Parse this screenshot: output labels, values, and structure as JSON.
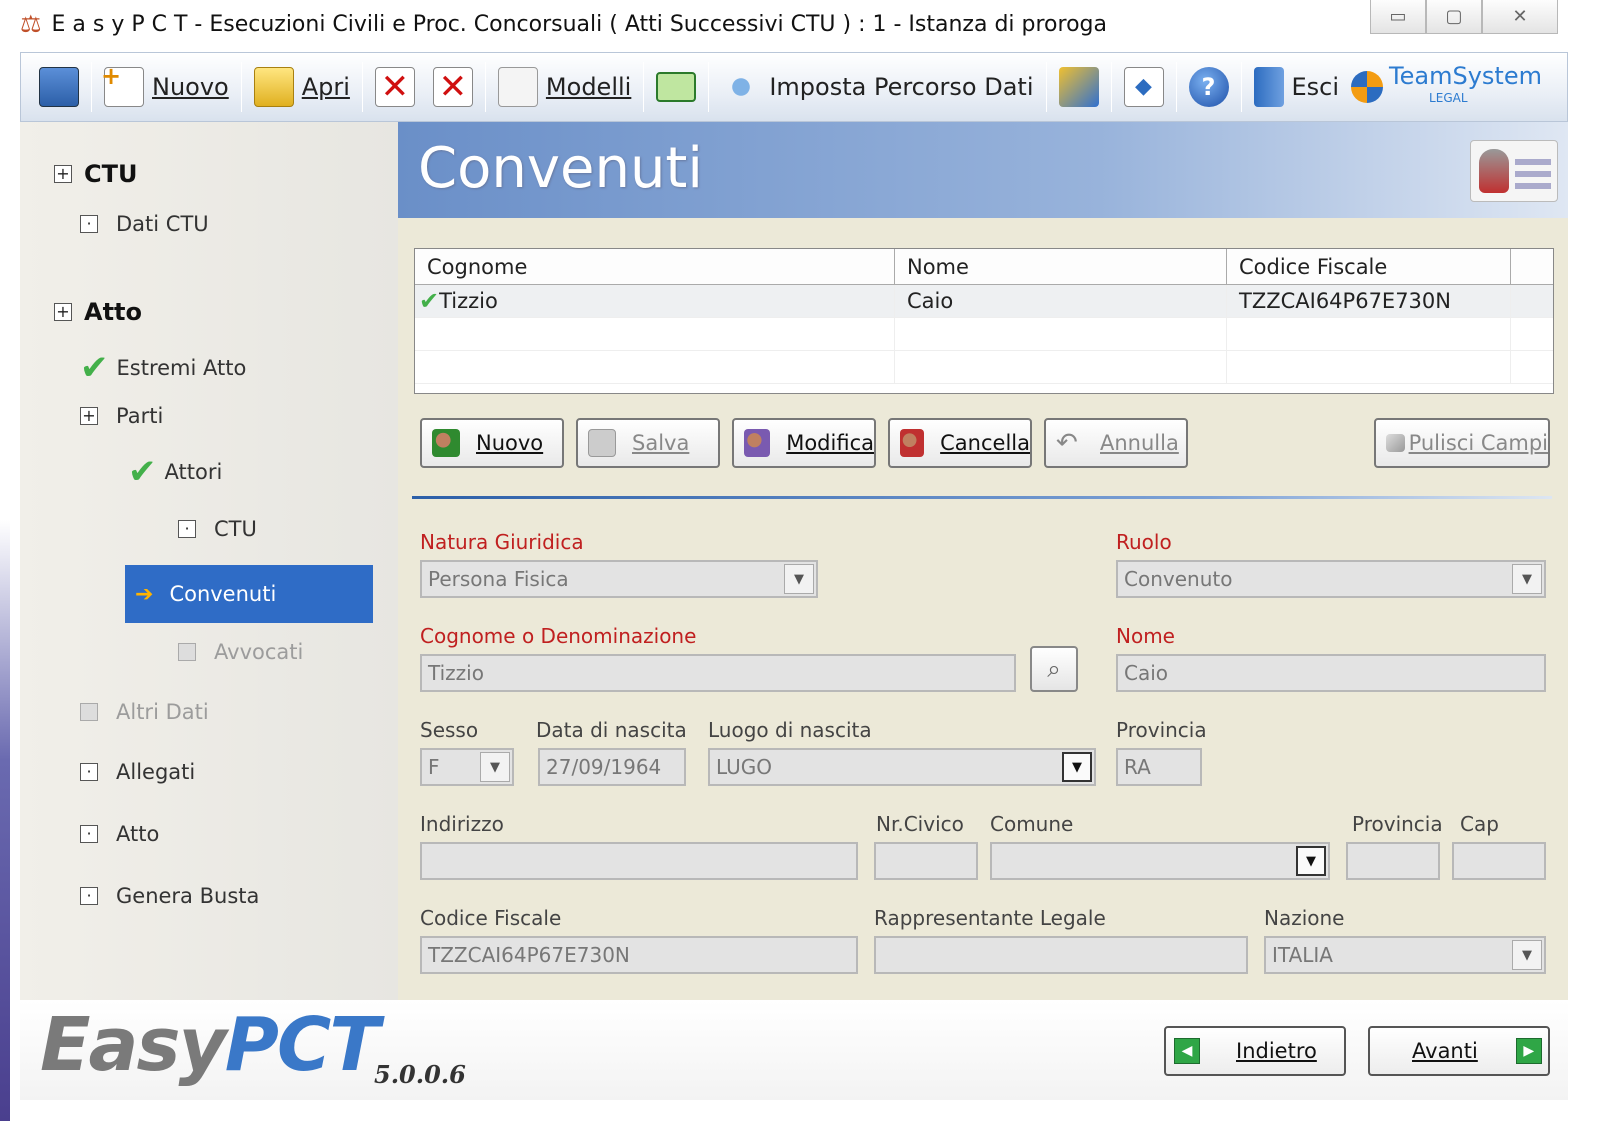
{
  "window": {
    "title": "E a s y P C T - Esecuzioni Civili e Proc. Concorsuali ( Atti Successivi CTU ) :  1 - Istanza di proroga"
  },
  "toolbar": {
    "nuovo": "Nuovo",
    "apri": "Apri",
    "modelli": "Modelli",
    "imposta": "Imposta Percorso Dati",
    "esci": "Esci",
    "brand": "TeamSystem",
    "brand_sub": "LEGAL"
  },
  "sidebar": {
    "group_ctu": "CTU",
    "dati_ctu": "Dati CTU",
    "group_atto": "Atto",
    "estremi": "Estremi Atto",
    "parti": "Parti",
    "attori": "Attori",
    "ctu": "CTU",
    "convenuti": "Convenuti",
    "avvocati": "Avvocati",
    "altri": "Altri Dati",
    "allegati": "Allegati",
    "atto": "Atto",
    "genera": "Genera Busta"
  },
  "header": {
    "title": "Convenuti"
  },
  "grid": {
    "columns": [
      "Cognome",
      "Nome",
      "Codice Fiscale"
    ],
    "rows": [
      {
        "cognome": "Tizzio",
        "nome": "Caio",
        "cf": "TZZCAI64P67E730N"
      }
    ]
  },
  "actions": {
    "nuovo": "Nuovo",
    "salva": "Salva",
    "modifica": "Modifica",
    "cancella": "Cancella",
    "annulla": "Annulla",
    "pulisci": "Pulisci Campi"
  },
  "form": {
    "natura_label": "Natura Giuridica",
    "natura_value": "Persona Fisica",
    "ruolo_label": "Ruolo",
    "ruolo_value": "Convenuto",
    "cognome_label": "Cognome o Denominazione",
    "cognome_value": "Tizzio",
    "nome_label": "Nome",
    "nome_value": "Caio",
    "sesso_label": "Sesso",
    "sesso_value": "F",
    "data_label": "Data di nascita",
    "data_value": "27/09/1964",
    "luogo_label": "Luogo di nascita",
    "luogo_value": "LUGO",
    "prov_label": "Provincia",
    "prov_value": "RA",
    "indirizzo_label": "Indirizzo",
    "civico_label": "Nr.Civico",
    "comune_label": "Comune",
    "prov2_label": "Provincia",
    "cap_label": "Cap",
    "cf_label": "Codice Fiscale",
    "cf_value": "TZZCAI64P67E730N",
    "rappr_label": "Rappresentante Legale",
    "nazione_label": "Nazione",
    "nazione_value": "ITALIA"
  },
  "footer": {
    "logo_a": "Easy",
    "logo_b": "PCT",
    "version": "5.0.0.6",
    "indietro": "Indietro",
    "avanti": "Avanti"
  },
  "colors": {
    "selection": "#2f6cc6",
    "required_label": "#c02020",
    "check": "#43b04a"
  }
}
